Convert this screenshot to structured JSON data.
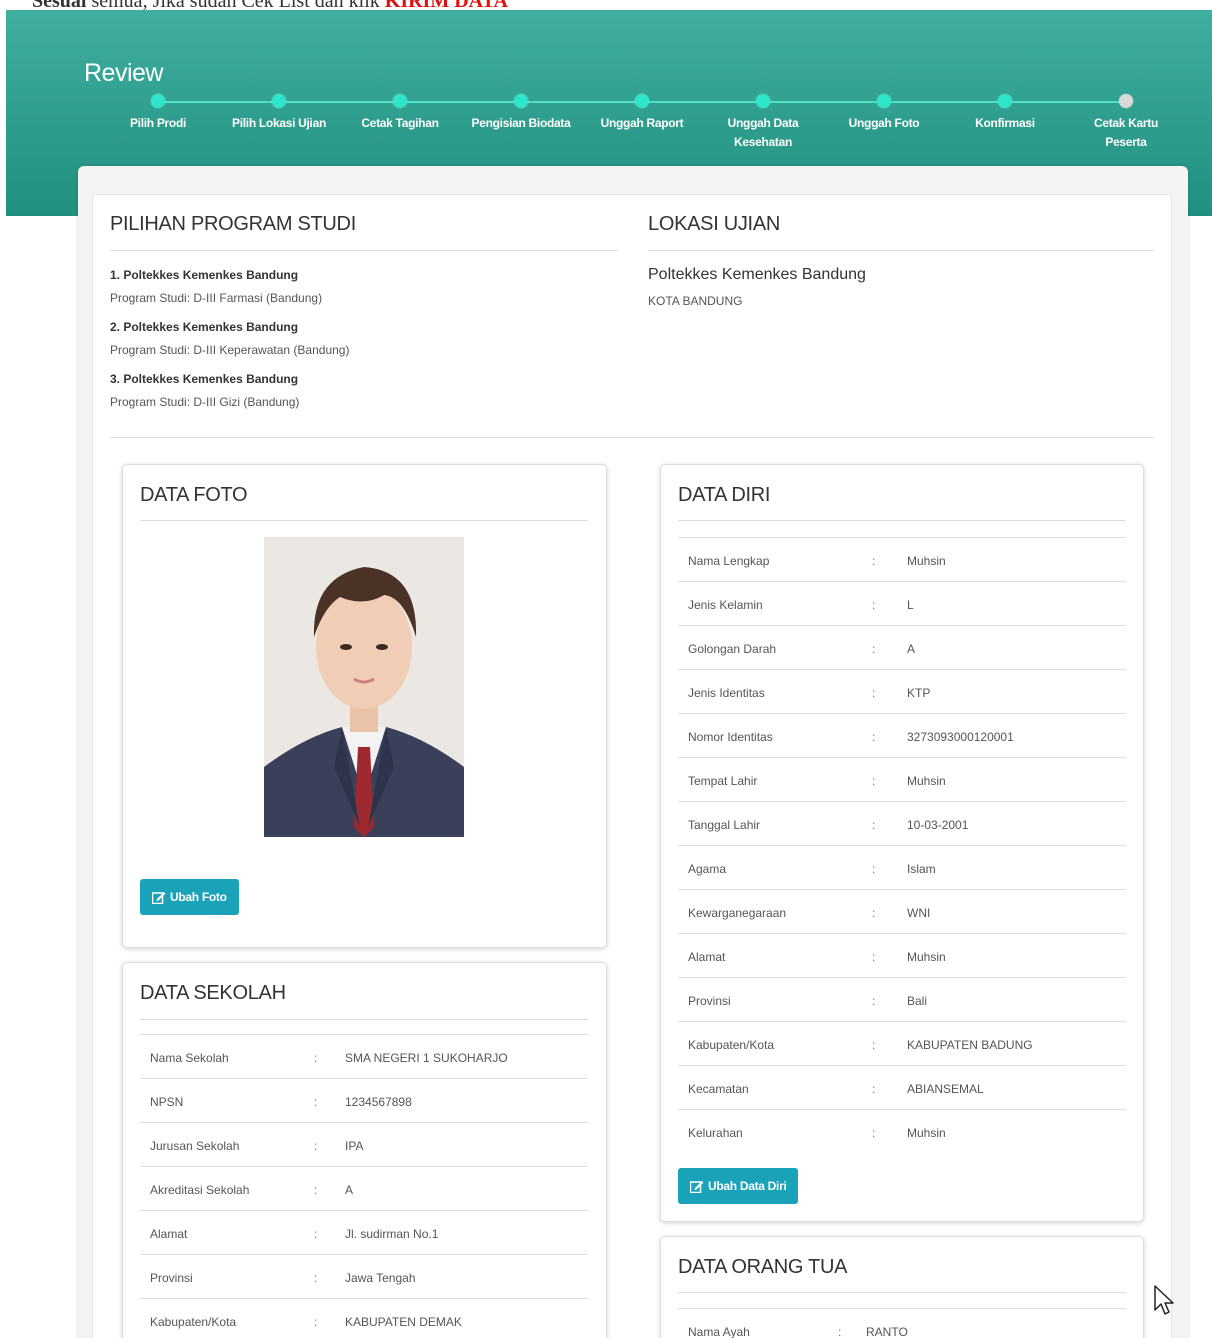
{
  "note": {
    "bold1": "Sesuai",
    "text": " semua, Jika sudah Cek List dan klik ",
    "bold2": "KIRIM DATA"
  },
  "page_title": "Review",
  "steps": [
    {
      "label": "Pilih Prodi"
    },
    {
      "label": "Pilih Lokasi Ujian"
    },
    {
      "label": "Cetak Tagihan"
    },
    {
      "label": "Pengisian Biodata"
    },
    {
      "label": "Unggah Raport"
    },
    {
      "label": "Unggah Data Kesehatan"
    },
    {
      "label": "Unggah Foto"
    },
    {
      "label": "Konfirmasi"
    },
    {
      "label": "Cetak Kartu Peserta"
    }
  ],
  "prodi": {
    "title": "PILIHAN PROGRAM STUDI",
    "items": [
      {
        "name": "1. Poltekkes Kemenkes Bandung",
        "program": "Program Studi: D-III Farmasi (Bandung)"
      },
      {
        "name": "2. Poltekkes Kemenkes Bandung",
        "program": "Program Studi: D-III Keperawatan (Bandung)"
      },
      {
        "name": "3. Poltekkes Kemenkes Bandung",
        "program": "Program Studi: D-III Gizi (Bandung)"
      }
    ]
  },
  "lokasi": {
    "title": "LOKASI UJIAN",
    "name": "Poltekkes Kemenkes Bandung",
    "city": "KOTA BANDUNG"
  },
  "foto": {
    "title": "DATA FOTO",
    "button": "Ubah Foto"
  },
  "sekolah": {
    "title": "DATA SEKOLAH",
    "rows": [
      {
        "label": "Nama Sekolah",
        "value": "SMA NEGERI 1 SUKOHARJO"
      },
      {
        "label": "NPSN",
        "value": "1234567898"
      },
      {
        "label": "Jurusan Sekolah",
        "value": "IPA"
      },
      {
        "label": "Akreditasi Sekolah",
        "value": "A"
      },
      {
        "label": "Alamat",
        "value": "Jl. sudirman No.1"
      },
      {
        "label": "Provinsi",
        "value": "Jawa Tengah"
      },
      {
        "label": "Kabupaten/Kota",
        "value": "KABUPATEN DEMAK"
      }
    ]
  },
  "diri": {
    "title": "DATA DIRI",
    "button": "Ubah Data Diri",
    "rows": [
      {
        "label": "Nama Lengkap",
        "value": "Muhsin"
      },
      {
        "label": "Jenis Kelamin",
        "value": "L"
      },
      {
        "label": "Golongan Darah",
        "value": "A"
      },
      {
        "label": "Jenis Identitas",
        "value": "KTP"
      },
      {
        "label": "Nomor Identitas",
        "value": "3273093000120001"
      },
      {
        "label": "Tempat Lahir",
        "value": "Muhsin"
      },
      {
        "label": "Tanggal Lahir",
        "value": "10-03-2001"
      },
      {
        "label": "Agama",
        "value": "Islam"
      },
      {
        "label": "Kewarganegaraan",
        "value": "WNI"
      },
      {
        "label": "Alamat",
        "value": "Muhsin"
      },
      {
        "label": "Provinsi",
        "value": "Bali"
      },
      {
        "label": "Kabupaten/Kota",
        "value": "KABUPATEN BADUNG"
      },
      {
        "label": "Kecamatan",
        "value": "ABIANSEMAL"
      },
      {
        "label": "Kelurahan",
        "value": "Muhsin"
      }
    ]
  },
  "ortu": {
    "title": "DATA ORANG TUA",
    "rows": [
      {
        "label": "Nama Ayah",
        "value": "RANTO"
      }
    ]
  },
  "separator": ":",
  "colors": {
    "hero_top": "#3fae9e",
    "hero_bottom": "#20907f",
    "step_dot": "#2de5c8",
    "button": "#1aa3b8",
    "alert": "#e01010"
  }
}
